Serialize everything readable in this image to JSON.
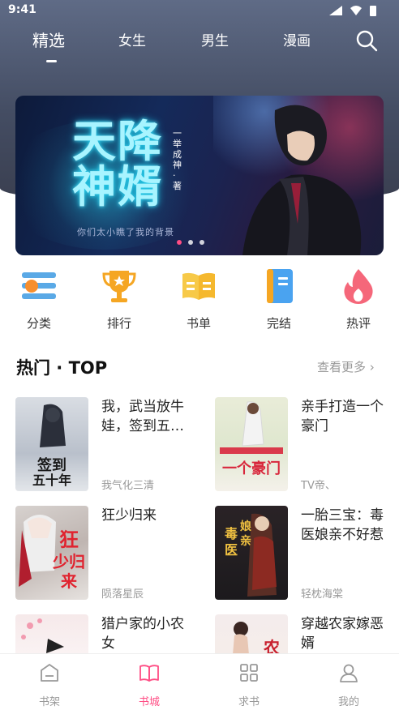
{
  "status": {
    "time": "9:41"
  },
  "tabs": [
    {
      "label": "精选"
    },
    {
      "label": "女生"
    },
    {
      "label": "男生"
    },
    {
      "label": "漫画"
    }
  ],
  "banner": {
    "title_line1": "天降",
    "title_line2": "神婿",
    "vertical_text": "一举成神·著",
    "tagline": "你们太小瞧了我的背景"
  },
  "categories": [
    {
      "label": "分类",
      "icon": "list-icon"
    },
    {
      "label": "排行",
      "icon": "trophy-icon"
    },
    {
      "label": "书单",
      "icon": "book-open-icon"
    },
    {
      "label": "完结",
      "icon": "book-icon"
    },
    {
      "label": "热评",
      "icon": "flame-icon"
    }
  ],
  "section": {
    "title": "热门 · TOP",
    "more": "查看更多"
  },
  "books": [
    {
      "title": "我，武当放牛娃，签到五十年",
      "author": "我气化三清",
      "cover_text": "签到五十年"
    },
    {
      "title": "亲手打造一个豪门",
      "author": "TV帝、",
      "cover_text": "一个豪门"
    },
    {
      "title": "狂少归来",
      "author": "陨落星辰",
      "cover_text": "狂少归来"
    },
    {
      "title": "一胎三宝：毒医娘亲不好惹",
      "author": "轻枕海棠",
      "cover_text": "毒医娘亲"
    },
    {
      "title": "猎户家的小农女",
      "author": "",
      "cover_text": ""
    },
    {
      "title": "穿越农家嫁恶婿",
      "author": "",
      "cover_text": ""
    }
  ],
  "tabbar": [
    {
      "label": "书架",
      "icon": "shelf-icon"
    },
    {
      "label": "书城",
      "icon": "store-icon"
    },
    {
      "label": "求书",
      "icon": "grid-icon"
    },
    {
      "label": "我的",
      "icon": "user-icon"
    }
  ],
  "colors": {
    "accent": "#ff4d84",
    "hero": "#4a536b",
    "muted": "#999999"
  }
}
